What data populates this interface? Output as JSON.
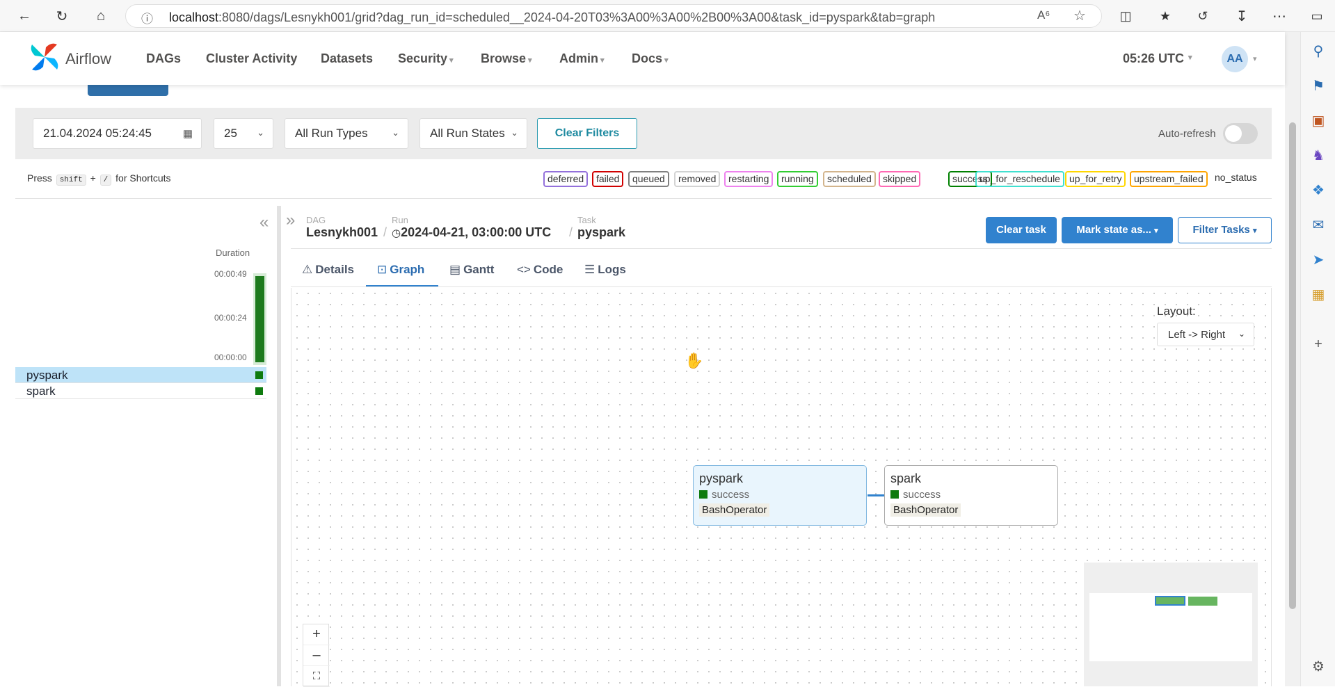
{
  "browser": {
    "url_host": "localhost",
    "url_rest": ":8080/dags/Lesnykh001/grid?dag_run_id=scheduled__2024-04-20T03%3A00%3A00%2B00%3A00&task_id=pyspark&tab=graph"
  },
  "nav": {
    "brand": "Airflow",
    "links": [
      "DAGs",
      "Cluster Activity",
      "Datasets",
      "Security",
      "Browse",
      "Admin",
      "Docs"
    ],
    "clock": "05:26 UTC",
    "avatar": "AA"
  },
  "filters": {
    "date": "21.04.2024 05:24:45",
    "count": "25",
    "run_types": "All Run Types",
    "run_states": "All Run States",
    "clear": "Clear Filters",
    "auto_refresh": "Auto-refresh"
  },
  "shortcuts": {
    "press": "Press",
    "key1": "shift",
    "plus": "+",
    "key2": "/",
    "suffix": "for Shortcuts"
  },
  "legend": [
    {
      "label": "deferred",
      "color": "#9370db"
    },
    {
      "label": "failed",
      "color": "#d00000"
    },
    {
      "label": "queued",
      "color": "#808080"
    },
    {
      "label": "removed",
      "color": "#d3d3d3"
    },
    {
      "label": "restarting",
      "color": "#ee82ee"
    },
    {
      "label": "running",
      "color": "#32cd32"
    },
    {
      "label": "scheduled",
      "color": "#d2b48c"
    },
    {
      "label": "skipped",
      "color": "#ff69b4"
    },
    {
      "label": "success",
      "color": "#008000"
    },
    {
      "label": "up_for_reschedule",
      "color": "#40e0d0"
    },
    {
      "label": "up_for_retry",
      "color": "#ffd700"
    },
    {
      "label": "upstream_failed",
      "color": "#ffa500"
    },
    {
      "label": "no_status",
      "color": "#ffffff"
    }
  ],
  "grid": {
    "duration_label": "Duration",
    "ticks": [
      "00:00:49",
      "00:00:24",
      "00:00:00"
    ],
    "tasks": [
      "pyspark",
      "spark"
    ]
  },
  "header": {
    "dag_label": "DAG",
    "dag": "Lesnykh001",
    "run_label": "Run",
    "run": "2024-04-21, 03:00:00 UTC",
    "task_label": "Task",
    "task": "pyspark",
    "clear_task": "Clear task",
    "mark_state": "Mark state as...",
    "filter_tasks": "Filter Tasks"
  },
  "tabs": [
    "Details",
    "Graph",
    "Gantt",
    "Code",
    "Logs"
  ],
  "graph": {
    "layout_label": "Layout:",
    "layout_value": "Left -> Right",
    "nodes": [
      {
        "name": "pyspark",
        "state": "success",
        "operator": "BashOperator"
      },
      {
        "name": "spark",
        "state": "success",
        "operator": "BashOperator"
      }
    ]
  }
}
